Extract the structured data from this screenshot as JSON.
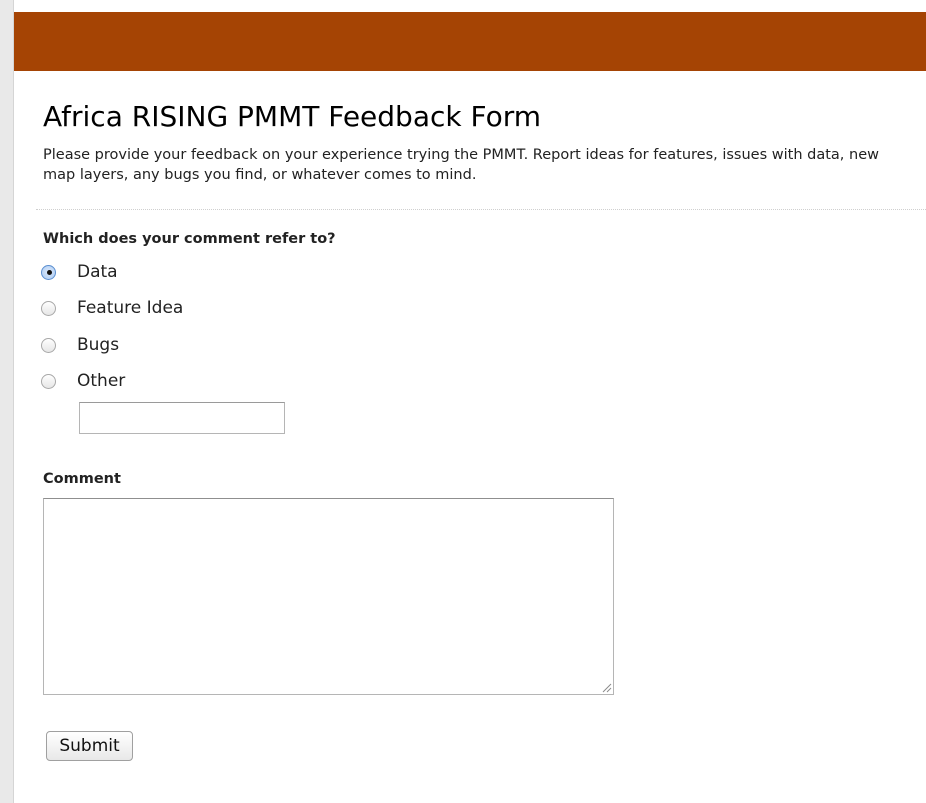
{
  "colors": {
    "header_bar": "#a54404",
    "radio_selected": "#5b8fd0"
  },
  "form": {
    "title": "Africa RISING PMMT Feedback Form",
    "description": "Please provide your feedback on your experience trying the PMMT. Report ideas for features, issues with data, new map layers, any bugs you find, or whatever comes to mind.",
    "question": {
      "label": "Which does your comment refer to?",
      "options": [
        {
          "label": "Data",
          "selected": true
        },
        {
          "label": "Feature Idea",
          "selected": false
        },
        {
          "label": "Bugs",
          "selected": false
        },
        {
          "label": "Other",
          "selected": false
        }
      ],
      "other_value": ""
    },
    "comment": {
      "label": "Comment",
      "value": ""
    },
    "submit_label": "Submit"
  },
  "icons": {
    "resize_grip": "resize-grip-icon"
  }
}
